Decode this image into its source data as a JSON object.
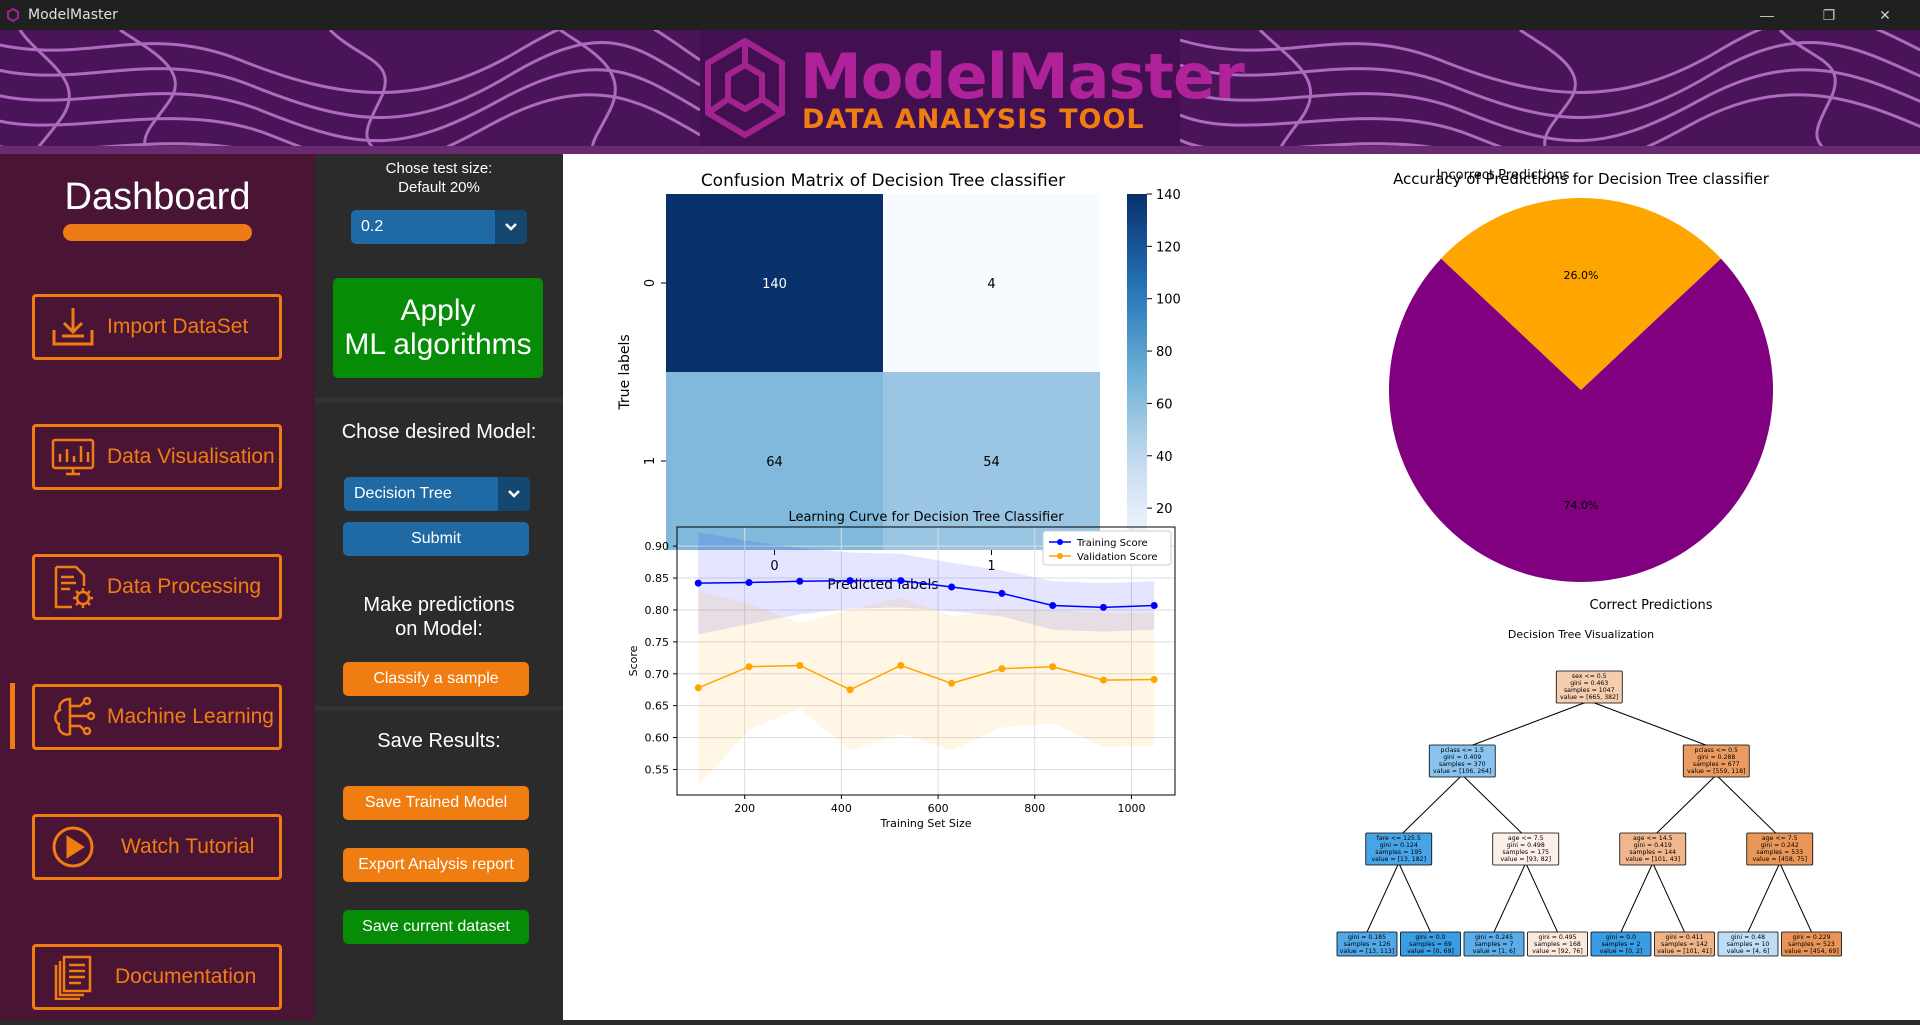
{
  "window": {
    "title": "ModelMaster",
    "minimize_glyph": "—",
    "restore_glyph": "❐",
    "close_glyph": "✕"
  },
  "banner": {
    "title": "ModelMaster",
    "subtitle": "DATA ANALYSIS TOOL"
  },
  "sidebar": {
    "title": "Dashboard",
    "items": [
      {
        "label": "Import DataSet",
        "icon": "import-icon"
      },
      {
        "label": "Data Visualisation",
        "icon": "monitor-chart-icon"
      },
      {
        "label": "Data Processing",
        "icon": "document-gear-icon"
      },
      {
        "label": "Machine Learning",
        "icon": "brain-circuit-icon"
      },
      {
        "label": "Watch Tutorial",
        "icon": "play-circle-icon"
      },
      {
        "label": "Documentation",
        "icon": "documents-icon"
      }
    ],
    "active_index": 3
  },
  "controls": {
    "test_size_label_1": "Chose test size:",
    "test_size_label_2": "Default 20%",
    "test_size_value": "0.2",
    "apply_line1": "Apply",
    "apply_line2": "ML algorithms",
    "model_label": "Chose desired Model:",
    "model_value": "Decision Tree",
    "submit_label": "Submit",
    "predict_label_1": "Make predictions",
    "predict_label_2": "on Model:",
    "classify_label": "Classify a sample",
    "save_results_label": "Save Results:",
    "save_model_label": "Save Trained Model",
    "export_label": "Export Analysis report",
    "save_dataset_label": "Save current dataset"
  },
  "colors": {
    "accent_orange": "#f07d12",
    "button_blue": "#1f6aa5",
    "apply_green": "#078c07",
    "pie_purple": "#800080",
    "pie_orange": "#ffa500",
    "train_blue": "#0000ff",
    "val_orange": "#ffa500"
  },
  "chart_data": [
    {
      "type": "heatmap",
      "title": "Confusion Matrix of Decision Tree classifier",
      "xlabel": "Predicted labels",
      "ylabel": "True labels",
      "x_ticks": [
        "0",
        "1"
      ],
      "y_ticks": [
        "0",
        "1"
      ],
      "values": [
        [
          140,
          4
        ],
        [
          64,
          54
        ]
      ],
      "colorbar_ticks": [
        20,
        40,
        60,
        80,
        100,
        120,
        140
      ],
      "colorbar_range": [
        4,
        140
      ],
      "colormap": "Blues"
    },
    {
      "type": "pie",
      "title": "Accuracy of Predictions for Decision Tree classifier",
      "slices": [
        {
          "label": "Correct Predictions",
          "value": 74.0,
          "pct_label": "74.0%",
          "color": "#800080"
        },
        {
          "label": "Incorrect Predictions",
          "value": 26.0,
          "pct_label": "26.0%",
          "color": "#ffa500"
        }
      ]
    },
    {
      "type": "line",
      "title": "Learning Curve for Decision Tree Classifier",
      "xlabel": "Training Set Size",
      "ylabel": "Score",
      "xlim": [
        60,
        1090
      ],
      "ylim": [
        0.51,
        0.93
      ],
      "x_ticks": [
        200,
        400,
        600,
        800,
        1000
      ],
      "y_ticks": [
        0.55,
        0.6,
        0.65,
        0.7,
        0.75,
        0.8,
        0.85,
        0.9
      ],
      "grid": true,
      "legend": "top-right",
      "x": [
        104,
        209,
        314,
        418,
        523,
        628,
        732,
        837,
        942,
        1047
      ],
      "series": [
        {
          "name": "Training Score",
          "color": "#0000ff",
          "values": [
            0.842,
            0.843,
            0.845,
            0.846,
            0.846,
            0.836,
            0.826,
            0.807,
            0.804,
            0.807
          ],
          "upper": [
            0.922,
            0.908,
            0.897,
            0.89,
            0.888,
            0.874,
            0.862,
            0.845,
            0.842,
            0.845
          ],
          "lower": [
            0.762,
            0.778,
            0.793,
            0.802,
            0.804,
            0.798,
            0.79,
            0.769,
            0.766,
            0.769
          ]
        },
        {
          "name": "Validation Score",
          "color": "#ffa500",
          "values": [
            0.678,
            0.711,
            0.713,
            0.675,
            0.713,
            0.685,
            0.708,
            0.711,
            0.69,
            0.691
          ],
          "upper": [
            0.83,
            0.81,
            0.78,
            0.8,
            0.82,
            0.79,
            0.8,
            0.8,
            0.795,
            0.795
          ],
          "lower": [
            0.525,
            0.612,
            0.646,
            0.58,
            0.606,
            0.58,
            0.616,
            0.622,
            0.585,
            0.587
          ]
        }
      ]
    },
    {
      "type": "table",
      "title": "Decision Tree Visualization",
      "nodes": [
        {
          "id": "n0",
          "level": 0,
          "col": 3.5,
          "lines": [
            "sex <= 0.5",
            "gini = 0.463",
            "samples = 1047",
            "value = [665, 382]"
          ],
          "color": "#f5ceb0"
        },
        {
          "id": "n1",
          "level": 1,
          "col": 1.5,
          "parent": "n0",
          "lines": [
            "pclass <= 1.5",
            "gini = 0.409",
            "samples = 370",
            "value = [106, 264]"
          ],
          "color": "#88c4ef"
        },
        {
          "id": "n2",
          "level": 1,
          "col": 5.5,
          "parent": "n0",
          "lines": [
            "pclass <= 0.5",
            "gini = 0.288",
            "samples = 677",
            "value = [559, 118]"
          ],
          "color": "#eb9c63"
        },
        {
          "id": "n3",
          "level": 2,
          "col": 0.5,
          "parent": "n1",
          "lines": [
            "fare <= 125.5",
            "gini = 0.124",
            "samples = 195",
            "value = [13, 182]"
          ],
          "color": "#47a4e7"
        },
        {
          "id": "n4",
          "level": 2,
          "col": 2.5,
          "parent": "n1",
          "lines": [
            "age <= 7.5",
            "gini = 0.498",
            "samples = 175",
            "value = [93, 82]"
          ],
          "color": "#fcf0e8"
        },
        {
          "id": "n5",
          "level": 2,
          "col": 4.5,
          "parent": "n2",
          "lines": [
            "age <= 14.5",
            "gini = 0.419",
            "samples = 144",
            "value = [101, 43]"
          ],
          "color": "#f0b68d"
        },
        {
          "id": "n6",
          "level": 2,
          "col": 6.5,
          "parent": "n2",
          "lines": [
            "age <= 7.5",
            "gini = 0.242",
            "samples = 533",
            "value = [458, 75]"
          ],
          "color": "#e99659"
        },
        {
          "id": "n7",
          "level": 3,
          "col": 0,
          "parent": "n3",
          "lines": [
            "gini = 0.185",
            "samples = 126",
            "value = [13, 113]"
          ],
          "color": "#50a8e8"
        },
        {
          "id": "n8",
          "level": 3,
          "col": 1,
          "parent": "n3",
          "lines": [
            "gini = 0.0",
            "samples = 69",
            "value = [0, 69]"
          ],
          "color": "#399de5"
        },
        {
          "id": "n9",
          "level": 3,
          "col": 2,
          "parent": "n4",
          "lines": [
            "gini = 0.245",
            "samples = 7",
            "value = [1, 6]"
          ],
          "color": "#5aade9"
        },
        {
          "id": "n10",
          "level": 3,
          "col": 3,
          "parent": "n4",
          "lines": [
            "gini = 0.495",
            "samples = 168",
            "value = [92, 76]"
          ],
          "color": "#fae9dc"
        },
        {
          "id": "n11",
          "level": 3,
          "col": 4,
          "parent": "n5",
          "lines": [
            "gini = 0.0",
            "samples = 2",
            "value = [0, 2]"
          ],
          "color": "#399de5"
        },
        {
          "id": "n12",
          "level": 3,
          "col": 5,
          "parent": "n5",
          "lines": [
            "gini = 0.411",
            "samples = 142",
            "value = [101, 41]"
          ],
          "color": "#f0b489"
        },
        {
          "id": "n13",
          "level": 3,
          "col": 6,
          "parent": "n6",
          "lines": [
            "gini = 0.48",
            "samples = 10",
            "value = [4, 6]"
          ],
          "color": "#bddef6"
        },
        {
          "id": "n14",
          "level": 3,
          "col": 7,
          "parent": "n6",
          "lines": [
            "gini = 0.229",
            "samples = 523",
            "value = [454, 69]"
          ],
          "color": "#e99457"
        }
      ]
    }
  ]
}
